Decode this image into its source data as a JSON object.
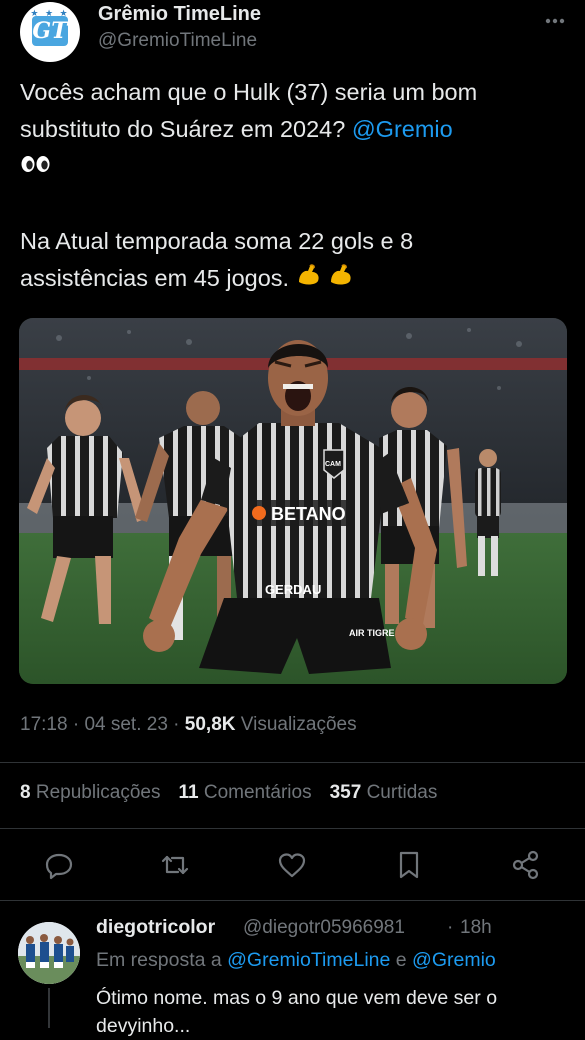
{
  "author": {
    "name": "Grêmio TimeLine",
    "handle": "@GremioTimeLine",
    "avatar_initials": "GT"
  },
  "tweet": {
    "line1": "Vocês acham que o Hulk (37) seria um bom",
    "line2": "substituto do Suárez em 2024? ",
    "mention": "@Gremio",
    "line3": "Na Atual temporada soma 22 gols e 8",
    "line4": "assistências em 45 jogos. ",
    "photo": {
      "jersey_sponsor": "BETANO",
      "jersey_back_sponsor": "GERDAU",
      "shorts_text": "AIR TIGRE",
      "crest": "CAM"
    }
  },
  "meta": {
    "time": "17:18",
    "sep1": " · ",
    "date": "04 set. 23",
    "sep2": " · ",
    "views_count": "50,8K",
    "views_label": " Visualizações"
  },
  "stats": {
    "reposts_count": "8",
    "reposts_label": " Republicações",
    "comments_count": "11",
    "comments_label": " Comentários",
    "likes_count": "357",
    "likes_label": " Curtidas"
  },
  "actions": [
    "reply-icon",
    "repost-icon",
    "like-icon",
    "bookmark-icon",
    "share-icon"
  ],
  "reply": {
    "name": "diegotricolor",
    "handle": "@diegotr05966981",
    "dot": "·",
    "time": "18h",
    "in_reply_prefix": "Em resposta a ",
    "in_reply_user1": "@GremioTimeLine",
    "in_reply_and": " e ",
    "in_reply_user2": "@Gremio",
    "text": "Ótimo  nome. mas o 9 ano que vem deve ser o devyinho..."
  },
  "colors": {
    "background": "#000000",
    "text": "#e7e9ea",
    "muted": "#71767b",
    "link": "#1d9bf0",
    "divider": "#2f3336"
  }
}
